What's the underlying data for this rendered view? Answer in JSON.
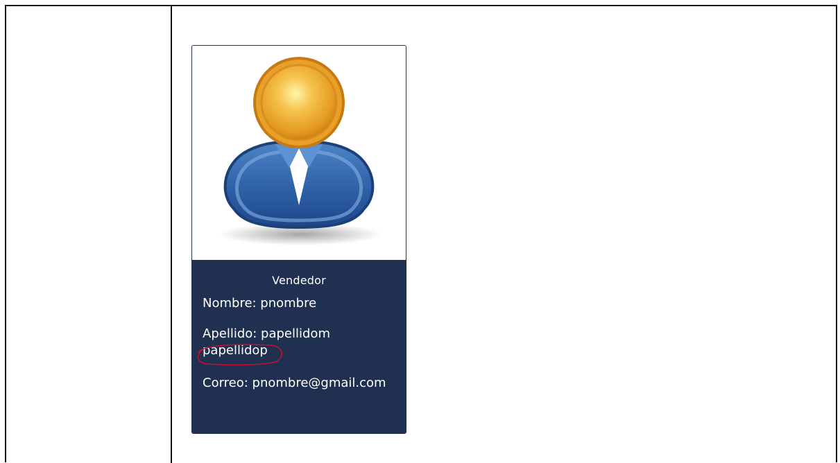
{
  "card": {
    "role": "Vendedor",
    "nombre": "Nombre: pnombre",
    "apellido": "Apellido: papellidom papellidop",
    "correo": "Correo: pnombre@gmail.com"
  },
  "icons": {
    "avatar": "user-avatar-icon",
    "annotation": "red-circle-annotation"
  },
  "colors": {
    "card_bg": "#1f3050",
    "card_text": "#ffffff",
    "avatar_head": "#f0a531",
    "avatar_body": "#2d5fa7",
    "annotation": "#c8102e"
  }
}
